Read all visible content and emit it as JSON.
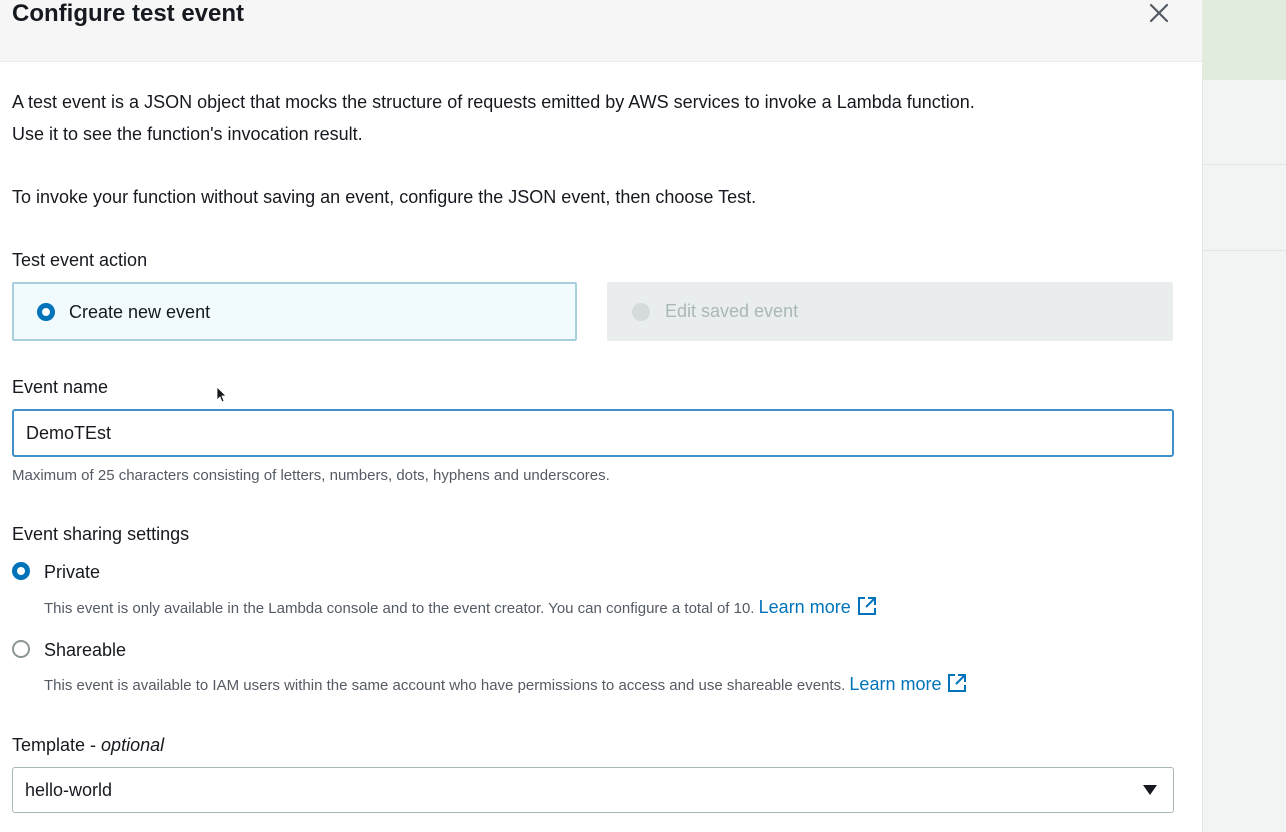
{
  "modal": {
    "title": "Configure test event",
    "close_icon": "close-icon"
  },
  "intro": {
    "line1": "A test event is a JSON object that mocks the structure of requests emitted by AWS services to invoke a Lambda function.",
    "line2": "Use it to see the function's invocation result.",
    "line3": "To invoke your function without saving an event, configure the JSON event, then choose Test."
  },
  "test_event_action": {
    "label": "Test event action",
    "options": [
      {
        "label": "Create new event",
        "selected": true,
        "disabled": false
      },
      {
        "label": "Edit saved event",
        "selected": false,
        "disabled": true
      }
    ]
  },
  "event_name": {
    "label": "Event name",
    "value": "DemoTEst",
    "hint": "Maximum of 25 characters consisting of letters, numbers, dots, hyphens and underscores."
  },
  "sharing": {
    "label": "Event sharing settings",
    "options": [
      {
        "label": "Private",
        "selected": true,
        "description": "This event is only available in the Lambda console and to the event creator. You can configure a total of 10.",
        "link": "Learn more"
      },
      {
        "label": "Shareable",
        "selected": false,
        "description": "This event is available to IAM users within the same account who have permissions to access and use shareable events.",
        "link": "Learn more"
      }
    ]
  },
  "template": {
    "label": "Template - ",
    "label_optional": "optional",
    "value": "hello-world"
  },
  "colors": {
    "accent": "#0073bb",
    "selected_tile_bg": "#f1fafc",
    "selected_tile_border": "#a8cfdc",
    "disabled_tile_bg": "#eaeded",
    "input_focus_border": "#3f90c8"
  }
}
